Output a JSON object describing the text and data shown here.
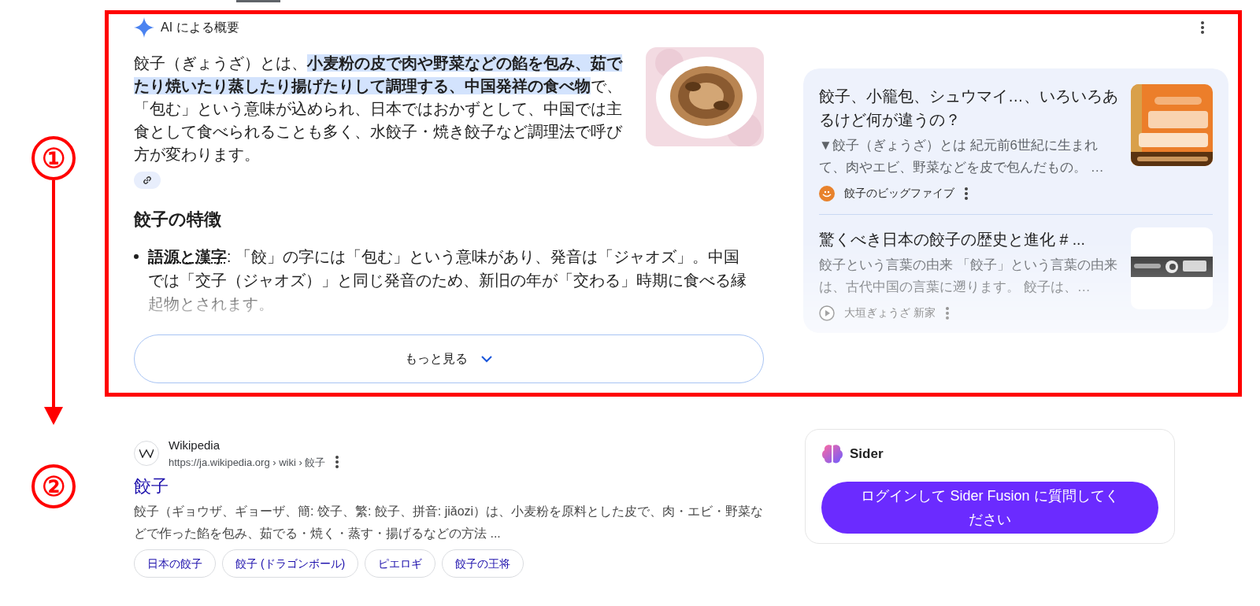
{
  "annotations": [
    {
      "label": "①"
    },
    {
      "label": "②"
    }
  ],
  "ai_overview": {
    "title": "AI による概要",
    "summary": "餃子（ぎょうざ）とは、**小麦粉の皮で肉や野菜などの餡を包み、茹でたり焼いたり蒸したり揚げたりして調理する、中国発祥の食べ物**で、「包む」という意味が込められ、日本ではおかずとして、中国では主食として食べられることも多く、水餃子・焼き餃子など調理法で呼び方が変わります。",
    "section_heading": "餃子の特徴",
    "bullets": [
      "**語源と漢字**: 「餃」の字には「包む」という意味があり、発音は「ジャオズ」。中国では「交子（ジャオズ）」と同じ発音のため、新旧の年が「交わる」時期に食べる縁起物とされます。"
    ],
    "more_button": "もっと見る",
    "sources": [
      {
        "title": "餃子、小籠包、シュウマイ…、いろいろあるけど何が違うの？",
        "snippet": "▼餃子（ぎょうざ）とは 紀元前6世紀に生まれて、肉やエビ、野菜などを皮で包んだもの。 …",
        "site": "餃子のビッグファイブ",
        "kind": "orange"
      },
      {
        "title": "驚くべき日本の餃子の歴史と進化 # ...",
        "snippet": "餃子という言葉の由来 「餃子」という言葉の由来は、古代中国の言葉に遡ります。 餃子は、…",
        "site": "大垣ぎょうざ 新家",
        "kind": "white"
      }
    ]
  },
  "result": {
    "site": "Wikipedia",
    "url": "https://ja.wikipedia.org › wiki › 餃子",
    "title": "餃子",
    "snippet": "餃子（ギョウザ、ギョーザ、簡: 饺子、繁: 餃子、拼音: jiǎozi）は、小麦粉を原料とした皮で、肉・エビ・野菜などで作った餡を包み、茹でる・焼く・蒸す・揚げるなどの方法 ...",
    "chips": [
      "日本の餃子",
      "餃子 (ドラゴンボール)",
      "ピエロギ",
      "餃子の王将"
    ]
  },
  "sider": {
    "name": "Sider",
    "button": "ログインして Sider Fusion に質問してください"
  }
}
